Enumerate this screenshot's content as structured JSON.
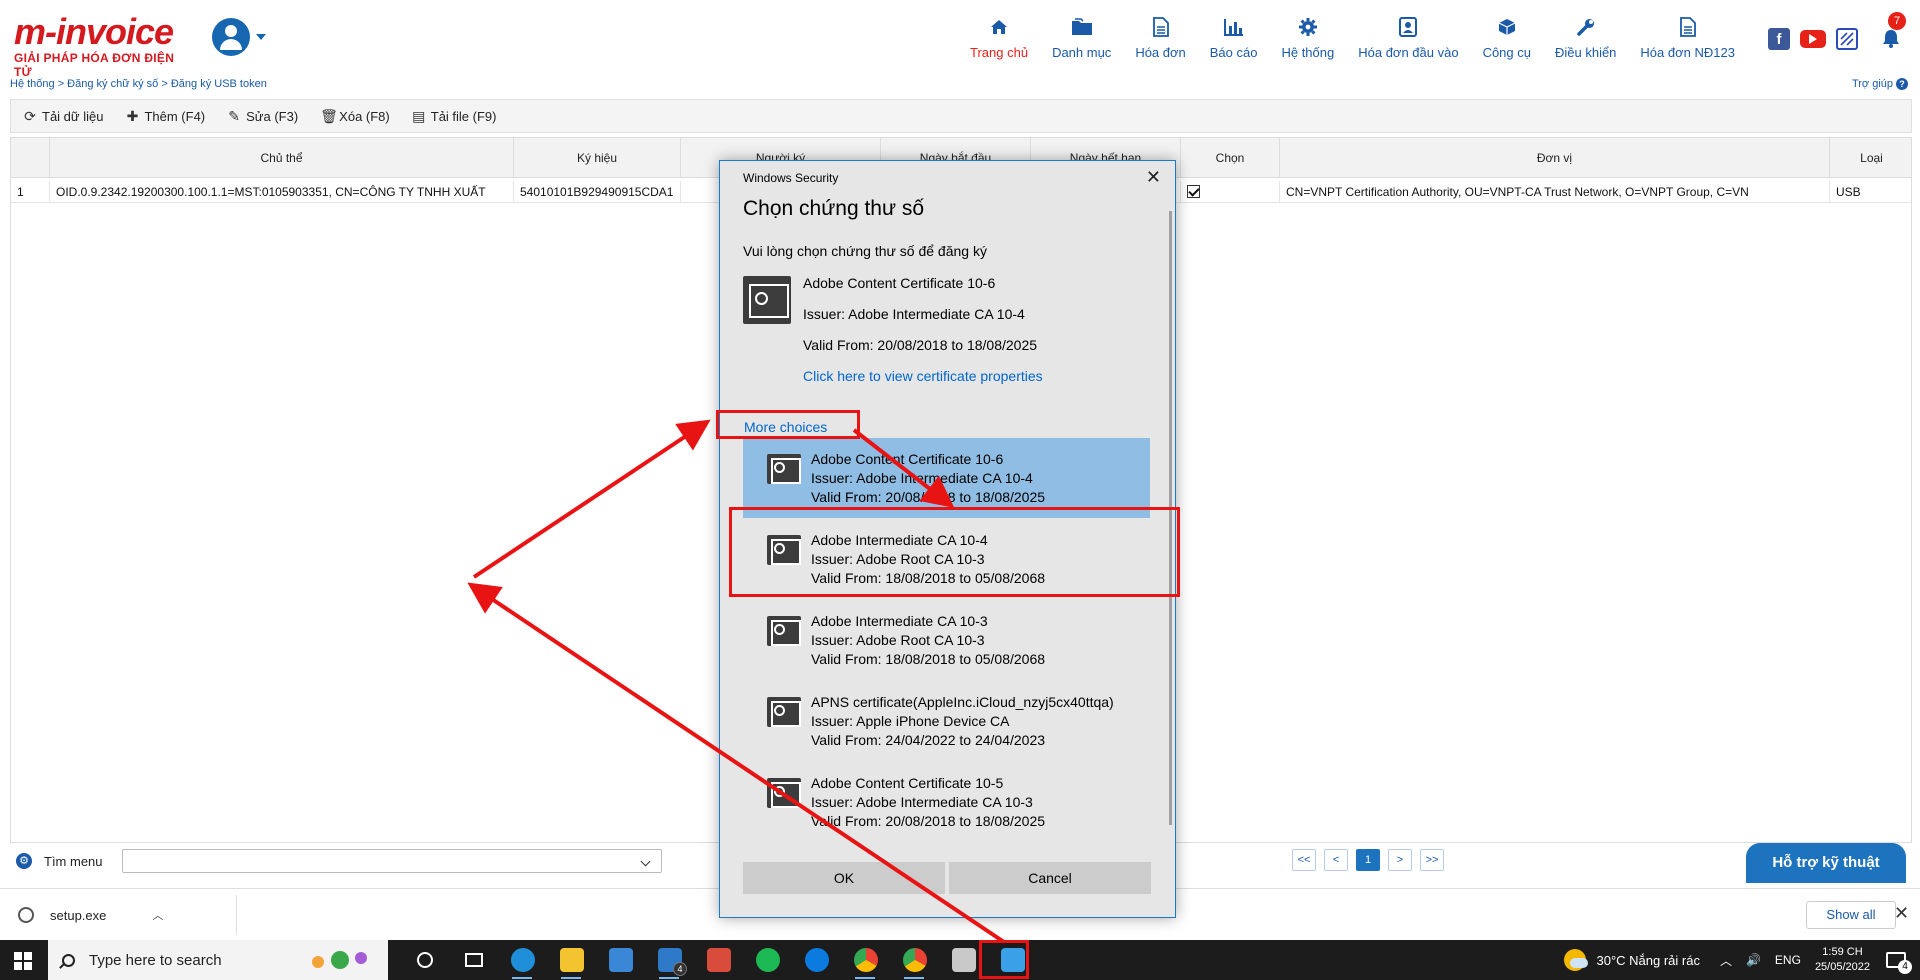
{
  "header": {
    "logo_main": "m-invoice",
    "logo_sub": "GIẢI PHÁP HÓA ĐƠN ĐIỆN TỬ",
    "notification_count": "7",
    "nav": [
      {
        "label": "Trang chủ",
        "icon": "home-icon",
        "active": true
      },
      {
        "label": "Danh mục",
        "icon": "folder-icon"
      },
      {
        "label": "Hóa đơn",
        "icon": "document-icon"
      },
      {
        "label": "Báo cáo",
        "icon": "bar-chart-icon"
      },
      {
        "label": "Hệ thống",
        "icon": "gear-icon"
      },
      {
        "label": "Hóa đơn đầu vào",
        "icon": "contact-card-icon"
      },
      {
        "label": "Công cụ",
        "icon": "box-icon"
      },
      {
        "label": "Điều khiển",
        "icon": "wrench-icon"
      },
      {
        "label": "Hóa đơn NĐ123",
        "icon": "file-icon"
      }
    ],
    "breadcrumb": "Hệ thống > Đăng ký chữ ký số > Đăng ký USB token",
    "help_label": "Trợ giúp"
  },
  "toolbar": {
    "reload": "Tải dữ liệu",
    "add": "Thêm (F4)",
    "edit": "Sửa (F3)",
    "delete": "Xóa (F8)",
    "download": "Tải file (F9)"
  },
  "grid": {
    "columns": [
      "Chủ thể",
      "Ký hiệu",
      "Người ký",
      "Ngày bắt đầu",
      "Ngày hết hạn",
      "Chọn",
      "Đơn vị",
      "Loại"
    ],
    "rows": [
      {
        "no": "1",
        "subject": "OID.0.9.2342.19200300.100.1.1=MST:0105903351, CN=CÔNG TY TNHH XUẤT",
        "serial": "54010101B929490915CDA1",
        "checked": true,
        "org": "CN=VNPT Certification Authority, OU=VNPT-CA Trust Network, O=VNPT Group, C=VN",
        "type": "USB"
      }
    ]
  },
  "footer": {
    "search_label": "Tìm menu",
    "pager": [
      "<<",
      "<",
      "1",
      ">",
      ">>"
    ],
    "current_page": "1",
    "support_label": "Hỗ trợ kỹ thuật"
  },
  "download_bar": {
    "file_name": "setup.exe",
    "show_all": "Show all"
  },
  "taskbar": {
    "search_placeholder": "Type here to search",
    "weather": "30°C  Nắng rải rác",
    "language": "ENG",
    "time": "1:59 CH",
    "date": "25/05/2022",
    "notifications": "4",
    "mail_badge": "4"
  },
  "dialog": {
    "window_title": "Windows Security",
    "heading": "Chọn chứng thư số",
    "description": "Vui lòng chọn chứng thư số để đăng ký",
    "selected": {
      "name": "Adobe Content Certificate 10-6",
      "issuer": "Issuer: Adobe Intermediate CA 10-4",
      "valid": "Valid From: 20/08/2018 to 18/08/2025",
      "properties_link": "Click here to view certificate properties"
    },
    "more_choices": "More choices",
    "certificates": [
      {
        "name": "Adobe Content Certificate 10-6",
        "issuer": "Issuer: Adobe Intermediate CA 10-4",
        "valid": "Valid From: 20/08/2018 to 18/08/2025",
        "selected": true
      },
      {
        "name": "Adobe Intermediate CA 10-4",
        "issuer": "Issuer: Adobe Root CA 10-3",
        "valid": "Valid From: 18/08/2018 to 05/08/2068"
      },
      {
        "name": "Adobe Intermediate CA 10-3",
        "issuer": "Issuer: Adobe Root CA 10-3",
        "valid": "Valid From: 18/08/2018 to 05/08/2068"
      },
      {
        "name": "APNS certificate(AppleInc.iCloud_nzyj5cx40ttqa)",
        "issuer": "Issuer: Apple iPhone Device CA",
        "valid": "Valid From: 24/04/2022 to 24/04/2023"
      },
      {
        "name": "Adobe Content Certificate 10-5",
        "issuer": "Issuer: Adobe Intermediate CA 10-3",
        "valid": "Valid From: 20/08/2018 to 18/08/2025"
      }
    ],
    "ok": "OK",
    "cancel": "Cancel"
  },
  "colors": {
    "brand_red": "#d4191f",
    "nav_blue": "#1a5aa8",
    "dialog_border": "#1979ca",
    "selected_item": "#90bde3",
    "annotation_red": "#e81414"
  }
}
